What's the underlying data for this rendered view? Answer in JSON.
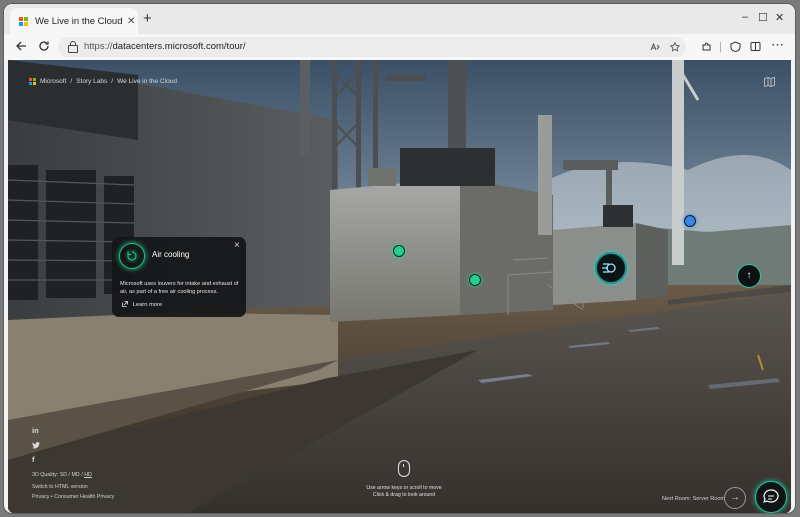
{
  "browser": {
    "tab_title": "We Live in the Cloud | M",
    "tab_close": "✕",
    "new_tab": "+",
    "url_protocol": "https://",
    "url_rest": "datacenters.microsoft.com/tour/",
    "window_controls": [
      "–",
      "☐",
      "✕"
    ]
  },
  "page": {
    "breadcrumb": {
      "brand": "Microsoft",
      "sep1": "/",
      "item1": "Story Labs",
      "sep2": "/",
      "item2": "We Live in the Cloud"
    },
    "popup": {
      "title": "Air cooling",
      "close": "×",
      "description": "Microsoft uses louvers for intake and exhaust of air, as part of a free air cooling process.",
      "link": "Learn more"
    },
    "social": {
      "linkedin": "in",
      "twitter": "🐦",
      "facebook": "f"
    },
    "footer": {
      "quality_label": "3D Quality:",
      "quality_sd": "SD",
      "quality_md": "MD",
      "quality_hd": "HD",
      "quality_sep": "/",
      "html_link": "Switch to HTML version",
      "privacy": "Privacy",
      "consumer_privacy": "Consumer Health Privacy",
      "bullet": "•"
    },
    "hint": {
      "line1": "Use arrow keys or scroll to move",
      "line2": "Click & drag to look around"
    },
    "next_room": "Next Room: Server Room",
    "next_arrow": "→",
    "up_arrow": "↑"
  },
  "colors": {
    "accent_green": "#1fbf87",
    "hotspot_blue": "#3b86e0",
    "ms_red": "#f25022",
    "ms_green": "#7fba00",
    "ms_blue": "#00a4ef",
    "ms_yellow": "#ffb900"
  }
}
